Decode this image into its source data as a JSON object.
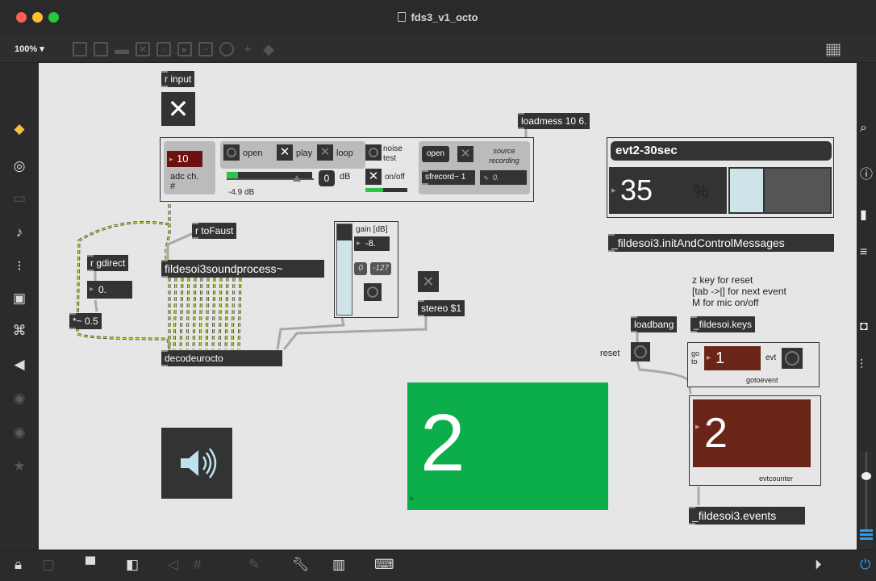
{
  "window": {
    "title": "fds3_v1_octo",
    "zoom": "100%"
  },
  "toolbar": {
    "icons": [
      "presentation-icon",
      "patcher-icon",
      "comment-icon",
      "toggle-icon",
      "bang-icon",
      "message-icon",
      "inlet-icon",
      "dial-icon",
      "add-icon",
      "paint-icon"
    ]
  },
  "objects": {
    "r_input": "r input",
    "loadmess": "loadmess 10 6.",
    "r_tofaust": "r toFaust",
    "r_gdirect": "r gdirect",
    "gdirect_value": "0.",
    "mul_half": "*~ 0.5",
    "soundprocess": "fildesoi3soundprocess~",
    "decodeurocto": "decodeurocto",
    "stereo": "stereo $1",
    "init_ctrl": "_fildesoi3.initAndControlMessages",
    "loadbang": "loadbang",
    "keys": "_fildesoi.keys",
    "events": "_fildesoi3.events"
  },
  "adc_panel": {
    "channel_value": "10",
    "channel_label": "adc ch. #",
    "open_label": "open",
    "play_label": "play",
    "loop_label": "loop",
    "noise_label": "noise test",
    "onoff_label": "on/off",
    "gain_readout": "-4.9 dB",
    "db_value": "0",
    "db_label": "dB",
    "rec_open": "open",
    "source_label": "source recording",
    "sfrecord": "sfrecord~ 1",
    "rec_time": "0."
  },
  "gain_panel": {
    "title": "gain [dB]",
    "value": "-8.",
    "btn_zero": "0",
    "btn_min": "-127"
  },
  "event_panel": {
    "name": "evt2-30sec",
    "percent_value": "35",
    "percent_sign": "%",
    "progress": 0.35
  },
  "notes": {
    "line1": "z key for reset",
    "line2": "[tab ->|] for next event",
    "line3": "M for mic on/off"
  },
  "goto_panel": {
    "goto_label": "go to",
    "goto_value": "1",
    "evt_label": "evt",
    "name": "gotoevent"
  },
  "reset_label": "reset",
  "big_number": "2",
  "counter_panel": {
    "value": "2",
    "name": "evtcounter"
  },
  "colors": {
    "canvas": "#e6e6e6",
    "object": "#333333",
    "green": "#0bae4a",
    "brown": "#6b2418",
    "redbox": "#6e1010",
    "patchcord": "#a8a8a8"
  }
}
